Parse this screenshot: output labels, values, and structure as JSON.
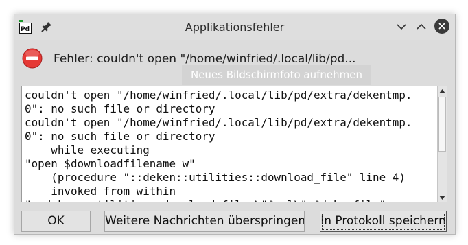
{
  "window": {
    "title": "Applikationsfehler",
    "app_icon_text": "Pd"
  },
  "titlebar_buttons": {
    "minimize_icon": "chevron-down-icon",
    "maximize_icon": "chevron-up-icon",
    "close_icon": "close-icon"
  },
  "error": {
    "icon": "error-icon",
    "headline": "Fehler: couldn't open \"/home/winfried/.local/lib/pd..."
  },
  "ghost_tooltip": {
    "text": "Neues Bildschirmfoto aufnehmen"
  },
  "details": {
    "text": "couldn't open \"/home/winfried/.local/lib/pd/extra/dekentmp.\n0\": no such file or directory\ncouldn't open \"/home/winfried/.local/lib/pd/extra/dekentmp.\n0\": no such file or directory\n    while executing\n\"open $downloadfilename w\"\n    (procedure \"::deken::utilities::download_file\" line 4)\n    invoked from within\n\"::deken::utilities::download_file \\\"$url\\\" $dekenfile\""
  },
  "buttons": {
    "ok": "OK",
    "skip": "Weitere Nachrichten überspringen",
    "save": "In Protokoll speichern"
  },
  "colors": {
    "dialog_bg": "#dcdcdc",
    "error_red": "#e53935",
    "close_button_bg": "#3a3a3a"
  }
}
